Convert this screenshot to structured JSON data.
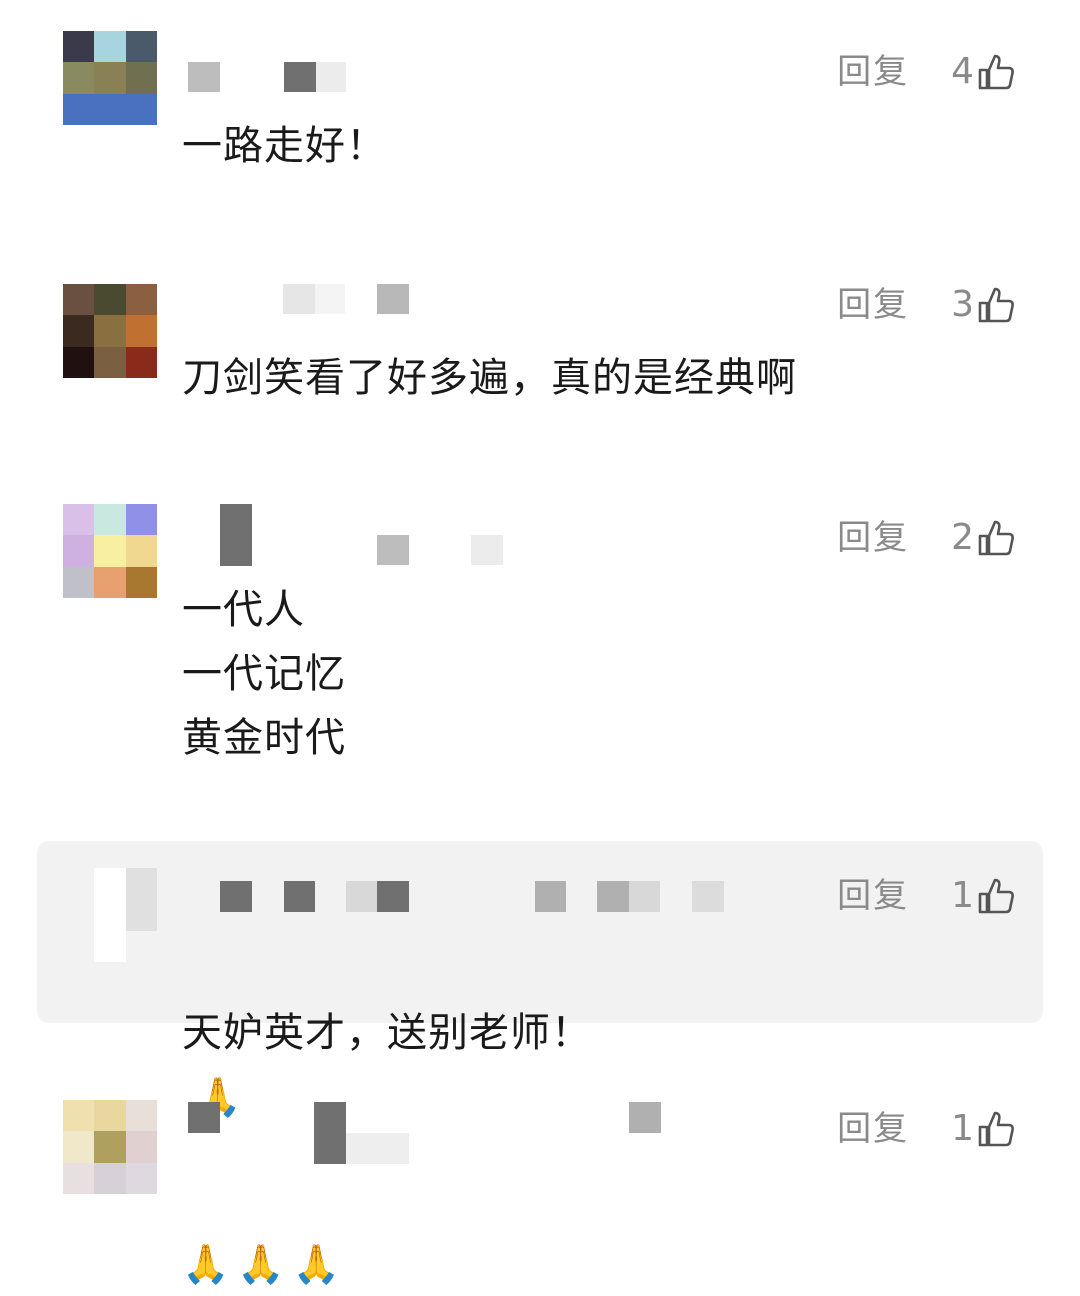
{
  "comments": [
    {
      "reply_label": "回复",
      "likes": "4",
      "text": "一路走好！",
      "avatar_colors": [
        "#3a3a4a",
        "#a8d4e0",
        "#4a5a6a",
        "#8a8a60",
        "#8a8055",
        "#707050",
        "#4a70c0",
        "#4a70c0",
        "#4a70c0"
      ]
    },
    {
      "reply_label": "回复",
      "likes": "3",
      "text": "刀剑笑看了好多遍，真的是经典啊",
      "avatar_colors": [
        "#6a5040",
        "#4a4a30",
        "#8a6040",
        "#3a2a20",
        "#8a7040",
        "#c07030",
        "#201010",
        "#7a6040",
        "#8a2a1a"
      ]
    },
    {
      "reply_label": "回复",
      "likes": "2",
      "text": "一代人\n一代记忆\n黄金时代",
      "avatar_colors": [
        "#d8c0e8",
        "#c8e8e0",
        "#9090e8",
        "#d0b0e0",
        "#f8f0a0",
        "#f0d890",
        "#c0c0c8",
        "#e8a070",
        "#a87830"
      ]
    },
    {
      "reply_label": "回复",
      "likes": "1",
      "text": "天妒英才，送别老师！",
      "emoji": "🙏",
      "highlighted": true,
      "avatar_colors": [
        "#f2f2f2",
        "#ffffff",
        "#e0e0e0",
        "#f2f2f2",
        "#ffffff",
        "#e0e0e0",
        "#f2f2f2",
        "#ffffff",
        "#f2f2f2"
      ]
    },
    {
      "reply_label": "回复",
      "likes": "1",
      "text": "",
      "emoji_row": "🙏🙏🙏",
      "avatar_colors": [
        "#f0e0b0",
        "#e8d8a0",
        "#e8e0d8",
        "#f0e8c8",
        "#b0a060",
        "#e0d0d0",
        "#e8e0e0",
        "#d8d0d8",
        "#e0d8e0"
      ]
    }
  ],
  "colors": {
    "text": "#1a1a1a",
    "meta": "#8a8a8a",
    "highlight_bg": "#f2f2f2"
  }
}
